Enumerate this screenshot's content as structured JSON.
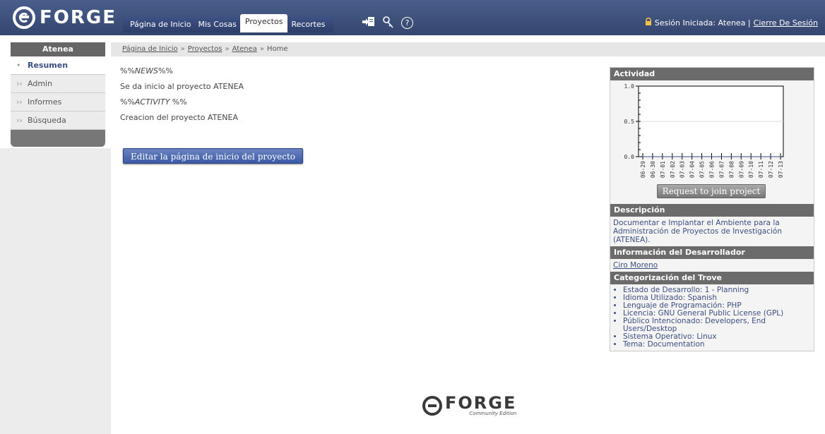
{
  "header": {
    "logo_text": "FORGE",
    "tabs": [
      {
        "label": "Página de Inicio",
        "active": false
      },
      {
        "label": "Mis Cosas",
        "active": false
      },
      {
        "label": "Proyectos",
        "active": true
      },
      {
        "label": "Recortes",
        "active": false
      }
    ],
    "icons": [
      "send-to-icon",
      "keys-icon",
      "help-icon"
    ],
    "session_label": "Sesión Iniciada: Atenea |",
    "logout_label": "Cierre De Sesión"
  },
  "sidebar": {
    "title": "Atenea",
    "items": [
      {
        "label": "Resumen",
        "active": true,
        "bullet": "•"
      },
      {
        "label": "Admin",
        "active": false,
        "bullet": "››"
      },
      {
        "label": "Informes",
        "active": false,
        "bullet": "››"
      },
      {
        "label": "Búsqueda",
        "active": false,
        "bullet": "››"
      }
    ]
  },
  "breadcrumb": {
    "items": [
      "Página de Inicio",
      "Proyectos",
      "Atenea"
    ],
    "current": "Home",
    "separator": "»"
  },
  "content": {
    "news_prefix": "%%",
    "news_token": "NEWS",
    "news_suffix": "%%",
    "news_text": "Se da inicio al proyecto ATENEA",
    "activity_prefix": "%%",
    "activity_token": "ACTIVITY",
    "activity_suffix": " %%",
    "activity_text": "Creacion del proyecto ATENEA",
    "edit_button": "Editar la página de inicio del proyecto"
  },
  "right": {
    "activity_title": "Actividad",
    "join_button": "Request to join project",
    "description_title": "Descripción",
    "description_text": "Documentar e Implantar el Ambiente para la Administración de Proyectos de Investigación (ATENEA).",
    "developer_title": "Información del Desarrollador",
    "developer_name": "Ciro Moreno",
    "trove_title": "Categorización del Trove",
    "trove_items": [
      "Estado de Desarrollo: 1 - Planning",
      "Idioma Utilizado: Spanish",
      "Lenguaje de Programación: PHP",
      "Licencia: GNU General Public License (GPL)",
      "Público Intencionado: Developers, End Users/Desktop",
      "Sistema Operativo: Linux",
      "Tema: Documentation"
    ]
  },
  "footer": {
    "logo_text": "FORGE",
    "logo_sub": "Community Edition"
  },
  "chart_data": {
    "type": "line",
    "title": "",
    "x": [
      "06-29",
      "06-30",
      "07-01",
      "07-02",
      "07-03",
      "07-04",
      "07-05",
      "07-06",
      "07-07",
      "07-08",
      "07-09",
      "07-10",
      "07-11",
      "07-12",
      "07-13"
    ],
    "series": [
      {
        "values": [
          0,
          0,
          0,
          0,
          0,
          0,
          0,
          0,
          0,
          0,
          0,
          0,
          0,
          0,
          0
        ]
      }
    ],
    "ylim": [
      0.0,
      1.0
    ],
    "yticks": [
      "0.0",
      "0.5",
      "1.0"
    ],
    "grid": true
  }
}
